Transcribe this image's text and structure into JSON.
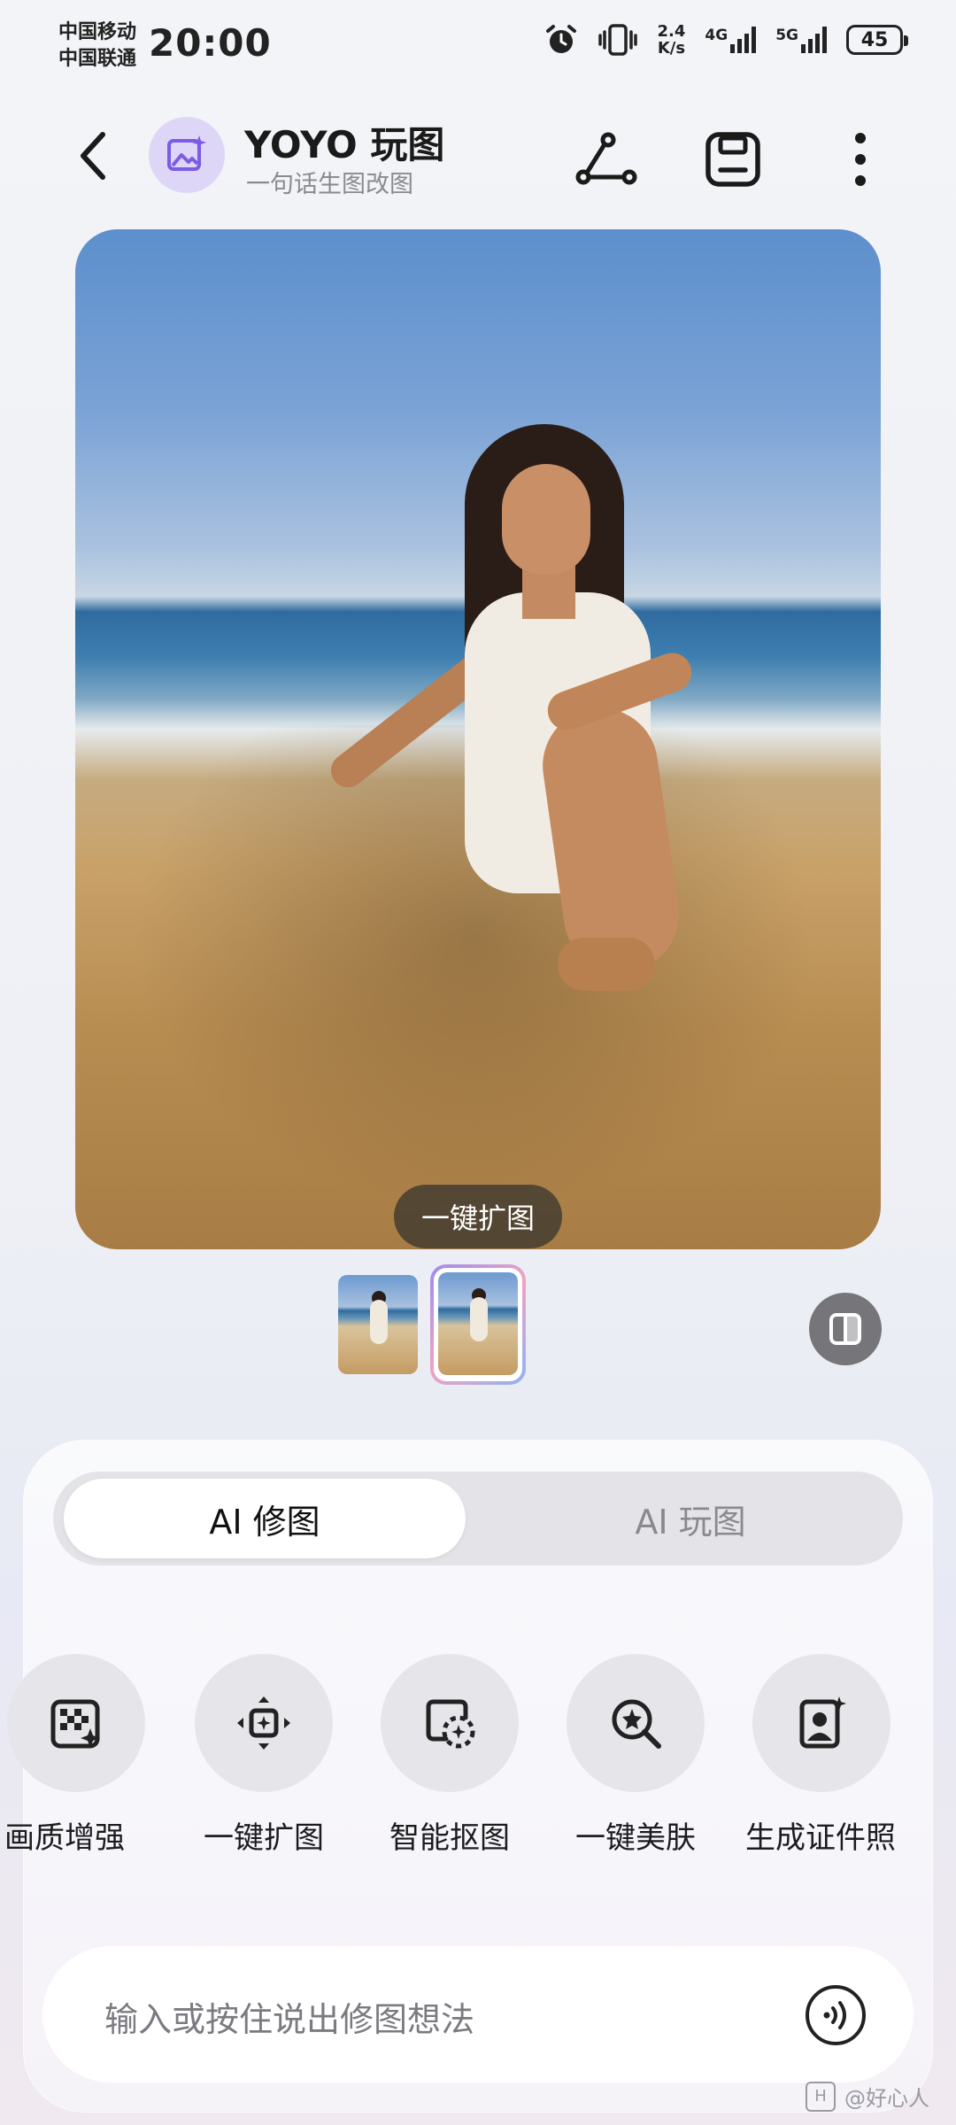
{
  "status_bar": {
    "carrier1": "中国移动",
    "carrier2": "中国联通",
    "time": "20:00",
    "speed_value": "2.4",
    "speed_unit": "K/s",
    "net1": "4G",
    "net2": "5G",
    "battery": "45"
  },
  "header": {
    "title": "YOYO 玩图",
    "subtitle": "一句话生图改图"
  },
  "photo": {
    "overlay_label": "一键扩图"
  },
  "tabs": [
    {
      "label": "AI 修图",
      "active": true
    },
    {
      "label": "AI 玩图",
      "active": false
    }
  ],
  "tools": [
    {
      "label": "画质增强",
      "icon": "quality-enhance-icon"
    },
    {
      "label": "一键扩图",
      "icon": "expand-image-icon"
    },
    {
      "label": "智能抠图",
      "icon": "smart-cutout-icon"
    },
    {
      "label": "一键美肤",
      "icon": "beautify-skin-icon"
    },
    {
      "label": "生成证件照",
      "icon": "id-photo-icon"
    }
  ],
  "input": {
    "placeholder": "输入或按住说出修图想法"
  },
  "watermark": {
    "text": "@好心人"
  },
  "colors": {
    "accent_purple": "#7b5ce6",
    "logo_bg": "#ddd6f7"
  }
}
